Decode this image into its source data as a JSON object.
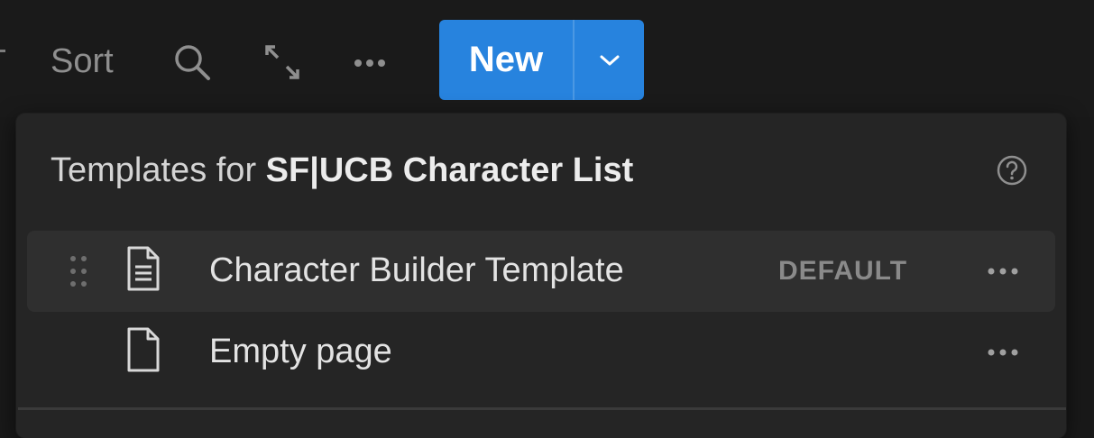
{
  "toolbar": {
    "sort_label": "Sort",
    "search_icon": "search-icon",
    "expand_icon": "expand-icon",
    "more_icon": "more-horizontal-icon",
    "new_label": "New",
    "new_dropdown_icon": "chevron-down-icon",
    "accent_color": "#2783de"
  },
  "templates_menu": {
    "title_prefix": "Templates for ",
    "database_name": "SF|UCB Character List",
    "help_icon": "help-circle-icon",
    "items": [
      {
        "label": "Character Builder Template",
        "badge": "DEFAULT",
        "icon": "document-lines-icon",
        "highlighted": true
      },
      {
        "label": "Empty page",
        "icon": "document-icon",
        "highlighted": false
      }
    ]
  }
}
